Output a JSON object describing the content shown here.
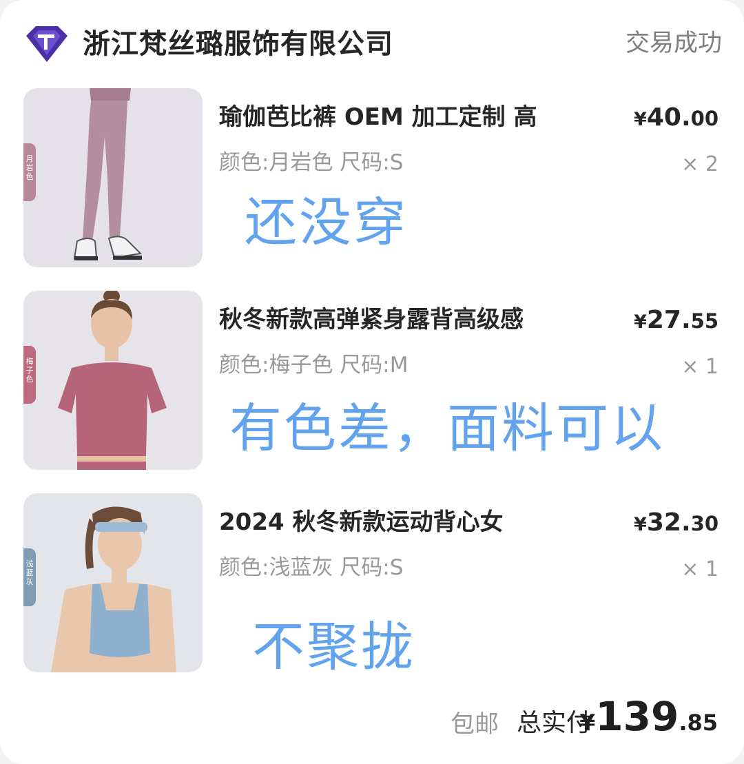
{
  "header": {
    "shop_name": "浙江梵丝璐服饰有限公司",
    "status": "交易成功"
  },
  "items": [
    {
      "title": "瑜伽芭比裤 OEM 加工定制 高",
      "spec": "颜色:月岩色 尺码:S",
      "price_symbol": "¥",
      "price_int": "40.",
      "price_dec": "00",
      "qty": "× 2",
      "annotation": "还没穿",
      "tag_label": [
        "月",
        "岩",
        "色"
      ],
      "tag_color": "#b88898",
      "product_color": "#b58e9e"
    },
    {
      "title": "秋冬新款高弹紧身露背高级感",
      "spec": "颜色:梅子色 尺码:M",
      "price_symbol": "¥",
      "price_int": "27.",
      "price_dec": "55",
      "qty": "× 1",
      "annotation": "有色差，面料可以",
      "tag_label": [
        "梅",
        "子",
        "色"
      ],
      "tag_color": "#bd6a80",
      "product_color": "#b6647a"
    },
    {
      "title": "2024 秋冬新款运动背心女",
      "spec": "颜色:浅蓝灰 尺码:S",
      "price_symbol": "¥",
      "price_int": "32.",
      "price_dec": "30",
      "qty": "× 1",
      "annotation": "不聚拢",
      "tag_label": [
        "浅",
        "蓝",
        "灰"
      ],
      "tag_color": "#7f9cb4",
      "product_color": "#8fb1cf"
    }
  ],
  "footer": {
    "shipping": "包邮",
    "total_label": "总实付",
    "total_symbol": "¥",
    "total_int": "139",
    "total_dec": ".85"
  },
  "colors": {
    "annotation": "#63a3ee",
    "logo": "#4b2fa6"
  }
}
